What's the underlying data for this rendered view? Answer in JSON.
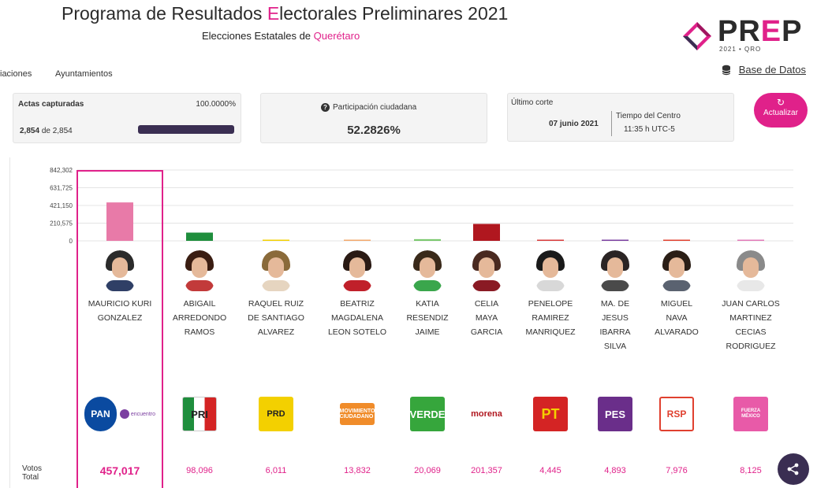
{
  "header": {
    "title_pre": "Programa de Resultados ",
    "title_accent": "E",
    "title_post": "lectorales Preliminares 2021",
    "subtitle_pre": "Elecciones Estatales de ",
    "subtitle_accent": "Querétaro"
  },
  "logo": {
    "text_pre": "PR",
    "text_accent": "E",
    "text_post": "P",
    "sub": "2021 • QRO"
  },
  "nav": {
    "item_1": "iaciones",
    "item_2": "Ayuntamientos"
  },
  "database_link": "Base de Datos",
  "actas": {
    "label": "Actas capturadas",
    "percent": "100.0000%",
    "count": "2,854",
    "of": "de",
    "total": "2,854",
    "progress_fraction": 1.0
  },
  "participacion": {
    "label": "Participación ciudadana",
    "value": "52.2826%"
  },
  "corte": {
    "label": "Último corte",
    "date": "07 junio 2021",
    "tz_label": "Tiempo del Centro",
    "time": "11:35 h UTC-5"
  },
  "refresh": {
    "icon": "refresh-icon",
    "label": "Actualizar"
  },
  "votes_label_1": "Votos",
  "votes_label_2": "Total",
  "chart_data": {
    "type": "bar",
    "ylim": [
      0,
      842302
    ],
    "yticks": [
      "842,302",
      "631,725",
      "421,150",
      "210,575",
      "0"
    ],
    "ytick_values": [
      842302,
      631725,
      421150,
      210575,
      0
    ],
    "grid": true,
    "categories": [
      "MAURICIO KURI GONZALEZ",
      "ABIGAIL ARREDONDO RAMOS",
      "RAQUEL RUIZ DE SANTIAGO ALVAREZ",
      "BEATRIZ MAGDALENA LEON SOTELO",
      "KATIA RESENDIZ JAIME",
      "CELIA MAYA GARCIA",
      "PENELOPE RAMIREZ MANRIQUEZ",
      "MA. DE JESUS IBARRA SILVA",
      "MIGUEL NAVA ALVARADO",
      "JUAN CARLOS MARTINEZ CECIAS RODRIGUEZ"
    ],
    "values": [
      457017,
      98096,
      6011,
      13832,
      20069,
      201357,
      4445,
      4893,
      7976,
      8125
    ],
    "colors": [
      "#e87aa8",
      "#1f8e3d",
      "#f3d000",
      "#f2a86b",
      "#7bc96f",
      "#b0171f",
      "#d83a3a",
      "#7b3fa0",
      "#e0402f",
      "#e27ab8"
    ]
  },
  "candidates": [
    {
      "name_lines": [
        "MAURICIO KURI",
        "GONZALEZ"
      ],
      "votes": "457,017",
      "party": "PAN",
      "party_color": "#0a4aa0",
      "hair": "#2b2b2b",
      "shirt": "#2f3f66"
    },
    {
      "name_lines": [
        "ABIGAIL",
        "ARREDONDO",
        "RAMOS"
      ],
      "votes": "98,096",
      "party": "PRI",
      "party_color": "#1f8e3d",
      "hair": "#3a1d12",
      "shirt": "#c23a3a"
    },
    {
      "name_lines": [
        "RAQUEL RUIZ",
        "DE SANTIAGO",
        "ALVAREZ"
      ],
      "votes": "6,011",
      "party": "PRD",
      "party_color": "#f3d000",
      "hair": "#8a6a3a",
      "shirt": "#e6d5c0"
    },
    {
      "name_lines": [
        "BEATRIZ",
        "MAGDALENA",
        "LEON SOTELO"
      ],
      "votes": "13,832",
      "party": "MOVIMIENTO CIUDADANO",
      "party_color": "#f08c2a",
      "hair": "#2a1a14",
      "shirt": "#c0202a"
    },
    {
      "name_lines": [
        "KATIA",
        "RESENDIZ",
        "JAIME"
      ],
      "votes": "20,069",
      "party": "VERDE",
      "party_color": "#36a63c",
      "hair": "#3a2a1a",
      "shirt": "#3aa64c"
    },
    {
      "name_lines": [
        "CELIA",
        "MAYA",
        "GARCIA"
      ],
      "votes": "201,357",
      "party": "morena",
      "party_color": "#b0171f",
      "hair": "#4a2a20",
      "shirt": "#8a1a24"
    },
    {
      "name_lines": [
        "PENELOPE",
        "RAMIREZ",
        "MANRIQUEZ"
      ],
      "votes": "4,445",
      "party": "PT",
      "party_color": "#d42424",
      "hair": "#1a1a1a",
      "shirt": "#d8d8d8"
    },
    {
      "name_lines": [
        "MA. DE",
        "JESUS",
        "IBARRA",
        "SILVA"
      ],
      "votes": "4,893",
      "party": "PES",
      "party_color": "#6a2e8a",
      "hair": "#2a2424",
      "shirt": "#4a4a4a"
    },
    {
      "name_lines": [
        "MIGUEL",
        "NAVA",
        "ALVARADO"
      ],
      "votes": "7,976",
      "party": "RSP",
      "party_color": "#e0402f",
      "hair": "#2a1e16",
      "shirt": "#5a6270"
    },
    {
      "name_lines": [
        "JUAN CARLOS",
        "MARTINEZ",
        "CECIAS",
        "RODRIGUEZ"
      ],
      "votes": "8,125",
      "party": "FUERZA MÉXICO",
      "party_color": "#e85aa8",
      "hair": "#8a8a8a",
      "shirt": "#e8e8e8"
    }
  ],
  "party_secondary": "encuentro",
  "share": {
    "icon": "share-icon"
  }
}
